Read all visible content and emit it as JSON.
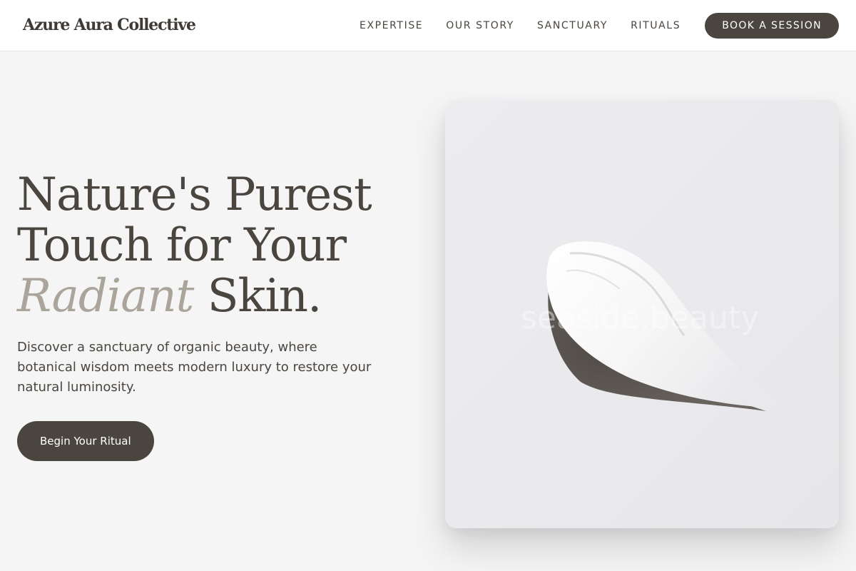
{
  "brand": {
    "name": "Azure Aura Collective"
  },
  "nav": {
    "links": [
      "EXPERTISE",
      "OUR STORY",
      "SANCTUARY",
      "RITUALS"
    ],
    "book_label": "BOOK A SESSION"
  },
  "hero": {
    "title_line1": "Nature's Purest",
    "title_line2": "Touch for Your",
    "title_accent": "Radiant",
    "title_end": "Skin.",
    "description": "Discover a sanctuary of organic beauty, where botanical wisdom meets modern luxury to restore your natural luminosity.",
    "cta_label": "Begin Your Ritual",
    "image": {
      "subject": "cream-swatch",
      "watermark": "seaside.beauty"
    }
  },
  "colors": {
    "primary": "#4a453f",
    "accent_text": "#aaa49b",
    "background": "#f5f5f5",
    "header_bg": "#ffffff"
  }
}
